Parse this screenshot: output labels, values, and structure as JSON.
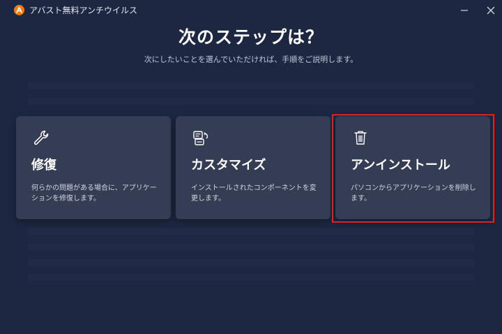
{
  "window": {
    "title": "アバスト無料アンチウイルス",
    "logo_icon": "avast-logo-icon",
    "minimize_icon": "minimize-icon",
    "close_icon": "close-icon"
  },
  "main": {
    "heading": "次のステップは？",
    "subheading": "次にしたいことを選んでいただければ、手順をご説明します。"
  },
  "cards": [
    {
      "icon": "wrench-icon",
      "title": "修復",
      "description": "何らかの問題がある場合に、アプリケーションを修復します。"
    },
    {
      "icon": "customize-icon",
      "title": "カスタマイズ",
      "description": "インストールされたコンポーネントを変更します。"
    },
    {
      "icon": "trash-icon",
      "title": "アンインストール",
      "description": "パソコンからアプリケーションを削除します。"
    }
  ],
  "colors": {
    "background": "#1e2742",
    "card": "#353d55",
    "brand_orange": "#ff7800",
    "highlight_red": "#e0241b"
  }
}
